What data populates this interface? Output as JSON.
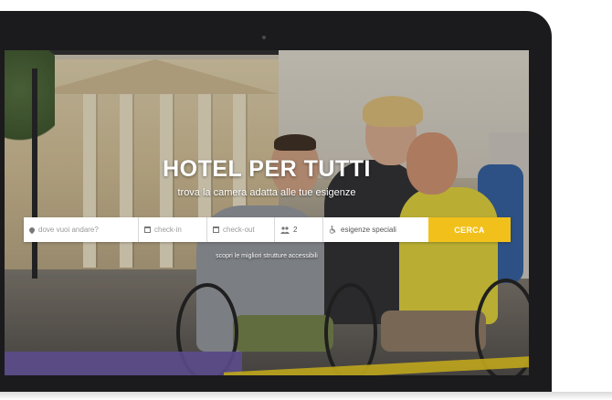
{
  "hero": {
    "title": "HOTEL PER TUTTI",
    "subtitle": "trova la camera adatta alle tue esigenze"
  },
  "search": {
    "destination_placeholder": "dove vuoi andare?",
    "checkin_placeholder": "check-in",
    "checkout_placeholder": "check-out",
    "guests_value": "2",
    "special_needs_label": "esigenze speciali",
    "submit_label": "CERCA"
  },
  "discover_link": "scopri le migliori strutture accessibili",
  "colors": {
    "accent": "#f2c01a",
    "hero_text": "#ffffff"
  },
  "icons": {
    "destination": "map-pin-icon",
    "checkin": "calendar-icon",
    "checkout": "calendar-icon",
    "guests": "people-icon",
    "special_needs": "wheelchair-icon"
  }
}
